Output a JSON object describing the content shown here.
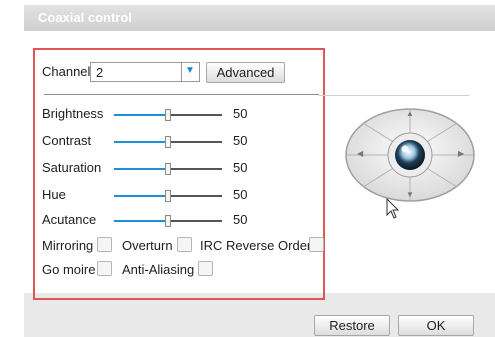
{
  "dialog": {
    "title": "Coaxial control"
  },
  "channel": {
    "label": "Channel",
    "value": "2"
  },
  "advanced_label": "Advanced",
  "sliders": [
    {
      "label": "Brightness",
      "value": "50",
      "level": 0.5
    },
    {
      "label": "Contrast",
      "value": "50",
      "level": 0.5
    },
    {
      "label": "Saturation",
      "value": "50",
      "level": 0.5
    },
    {
      "label": "Hue",
      "value": "50",
      "level": 0.5
    },
    {
      "label": "Acutance",
      "value": "50",
      "level": 0.5
    }
  ],
  "checkboxes": [
    {
      "label": "Mirroring",
      "checked": false
    },
    {
      "label": "Overturn",
      "checked": false
    },
    {
      "label": "IRC Reverse Order",
      "checked": false
    },
    {
      "label": "Go moire",
      "checked": false
    },
    {
      "label": "Anti-Aliasing",
      "checked": false
    }
  ],
  "buttons": {
    "restore": "Restore",
    "ok": "OK"
  },
  "colors": {
    "accent": "#1f8fd8",
    "highlight_border": "#e05555"
  }
}
